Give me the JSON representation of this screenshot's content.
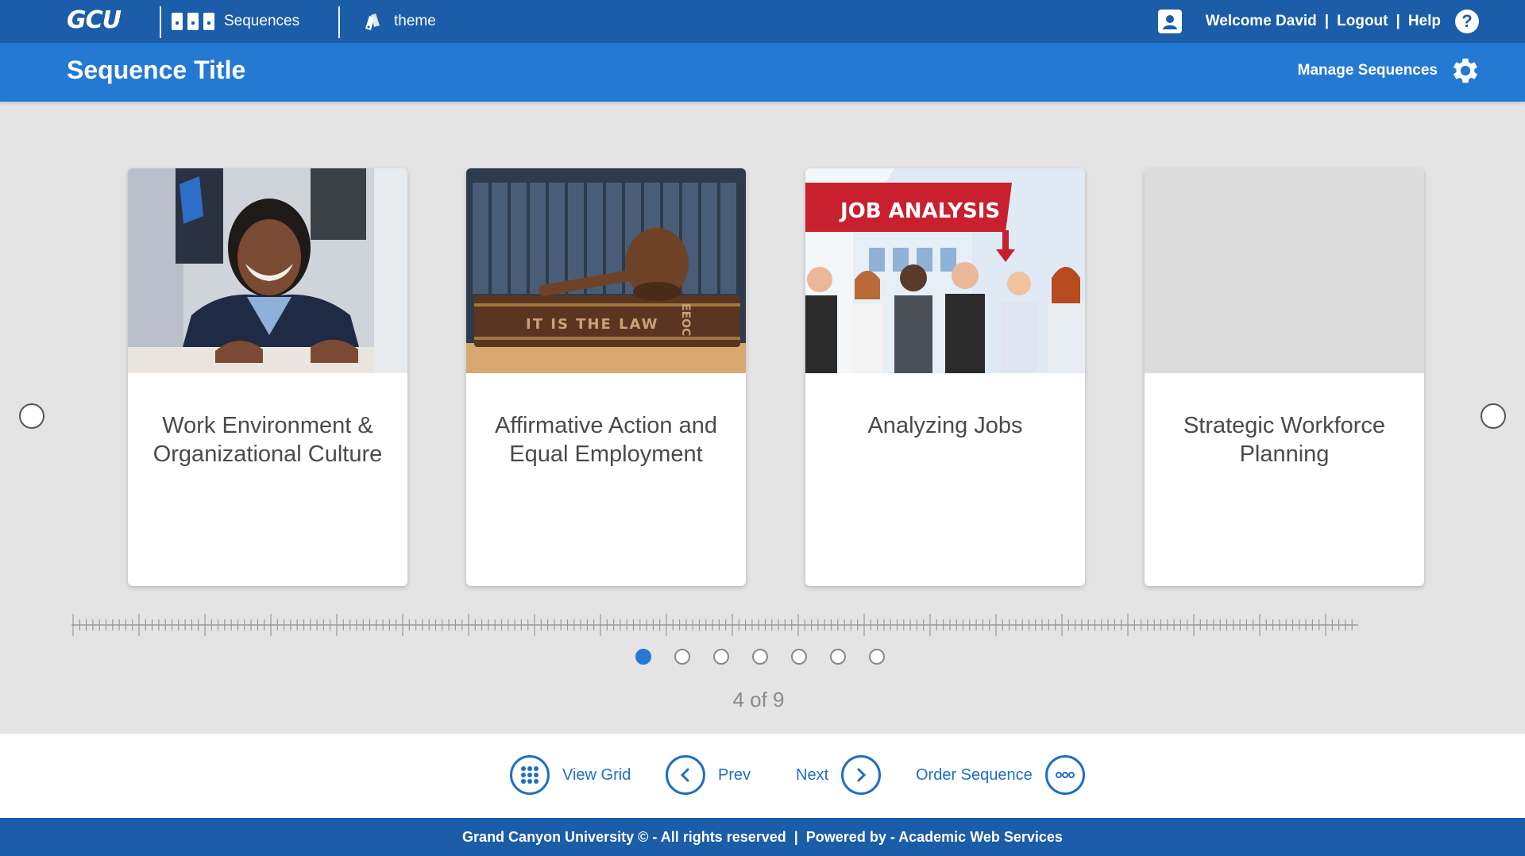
{
  "topbar": {
    "logo": "GCU",
    "sequences_label": "Sequences",
    "theme_label": "theme",
    "welcome": "Welcome David",
    "logout": "Logout",
    "help": "Help",
    "separator": "|"
  },
  "titlebar": {
    "title": "Sequence Title",
    "manage_label": "Manage Sequences"
  },
  "cards": [
    {
      "title": "Work Environment & Organizational Culture",
      "image": "smiling-businesswoman-photo"
    },
    {
      "title": "Affirmative Action and Equal Employment",
      "image": "gavel-on-law-book-photo",
      "book_text": "IT IS THE LAW",
      "spine_text": "EEOC"
    },
    {
      "title": "Analyzing Jobs",
      "image": "job-analysis-illustration",
      "banner_text": "JOB ANALYSIS"
    },
    {
      "title": "Strategic Workforce Planning",
      "image": "placeholder"
    }
  ],
  "pagination": {
    "dot_count": 7,
    "active_index": 0,
    "count_text": "4 of 9"
  },
  "bottomnav": {
    "view_grid": "View Grid",
    "prev": "Prev",
    "next": "Next",
    "order_sequence": "Order Sequence"
  },
  "footer": {
    "text": "Grand Canyon University © - All rights reserved  |  Powered by - Academic Web Services"
  },
  "colors": {
    "topbar": "#1b5da8",
    "titlebar": "#2479d3",
    "accent": "#1f6fc4",
    "background": "#e4e4e4"
  }
}
